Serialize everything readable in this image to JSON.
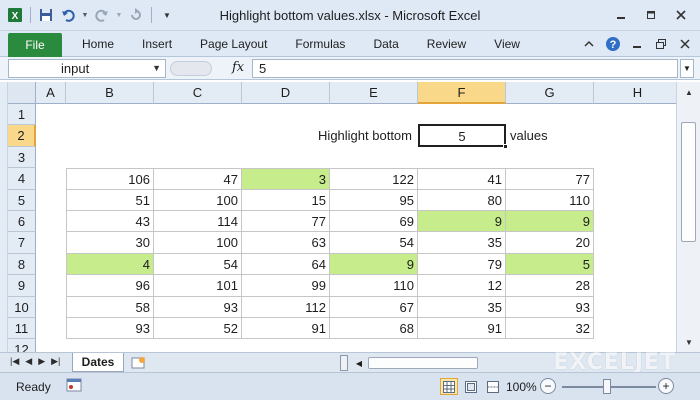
{
  "window": {
    "title": "Highlight bottom values.xlsx - Microsoft Excel"
  },
  "ribbon": {
    "file_tab": "File",
    "tabs": [
      "Home",
      "Insert",
      "Page Layout",
      "Formulas",
      "Data",
      "Review",
      "View"
    ]
  },
  "formula_bar": {
    "name_box": "input",
    "fx_label": "fx",
    "formula": "5"
  },
  "sheet": {
    "columns": [
      "A",
      "B",
      "C",
      "D",
      "E",
      "F",
      "G",
      "H"
    ],
    "selected_column": "F",
    "rows": [
      "1",
      "2",
      "3",
      "4",
      "5",
      "6",
      "7",
      "8",
      "9",
      "10",
      "11",
      "12"
    ],
    "selected_row": "2",
    "label_text": "Highlight bottom",
    "input_value": "5",
    "values_text": "values",
    "highlight_color": "#c6ec8c",
    "table": [
      [
        106,
        47,
        3,
        122,
        41,
        77
      ],
      [
        51,
        100,
        15,
        95,
        80,
        110
      ],
      [
        43,
        114,
        77,
        69,
        9,
        9
      ],
      [
        30,
        100,
        63,
        54,
        35,
        20
      ],
      [
        4,
        54,
        64,
        9,
        79,
        5
      ],
      [
        96,
        101,
        99,
        110,
        12,
        28
      ],
      [
        58,
        93,
        112,
        67,
        35,
        93
      ],
      [
        93,
        52,
        91,
        68,
        91,
        32
      ]
    ],
    "highlighted": [
      [
        0,
        2
      ],
      [
        2,
        4
      ],
      [
        2,
        5
      ],
      [
        4,
        0
      ],
      [
        4,
        3
      ],
      [
        4,
        5
      ]
    ]
  },
  "sheet_tabs": {
    "active": "Dates"
  },
  "watermark": {
    "text": "EXCELJET"
  },
  "status": {
    "ready": "Ready",
    "zoom": "100%"
  }
}
